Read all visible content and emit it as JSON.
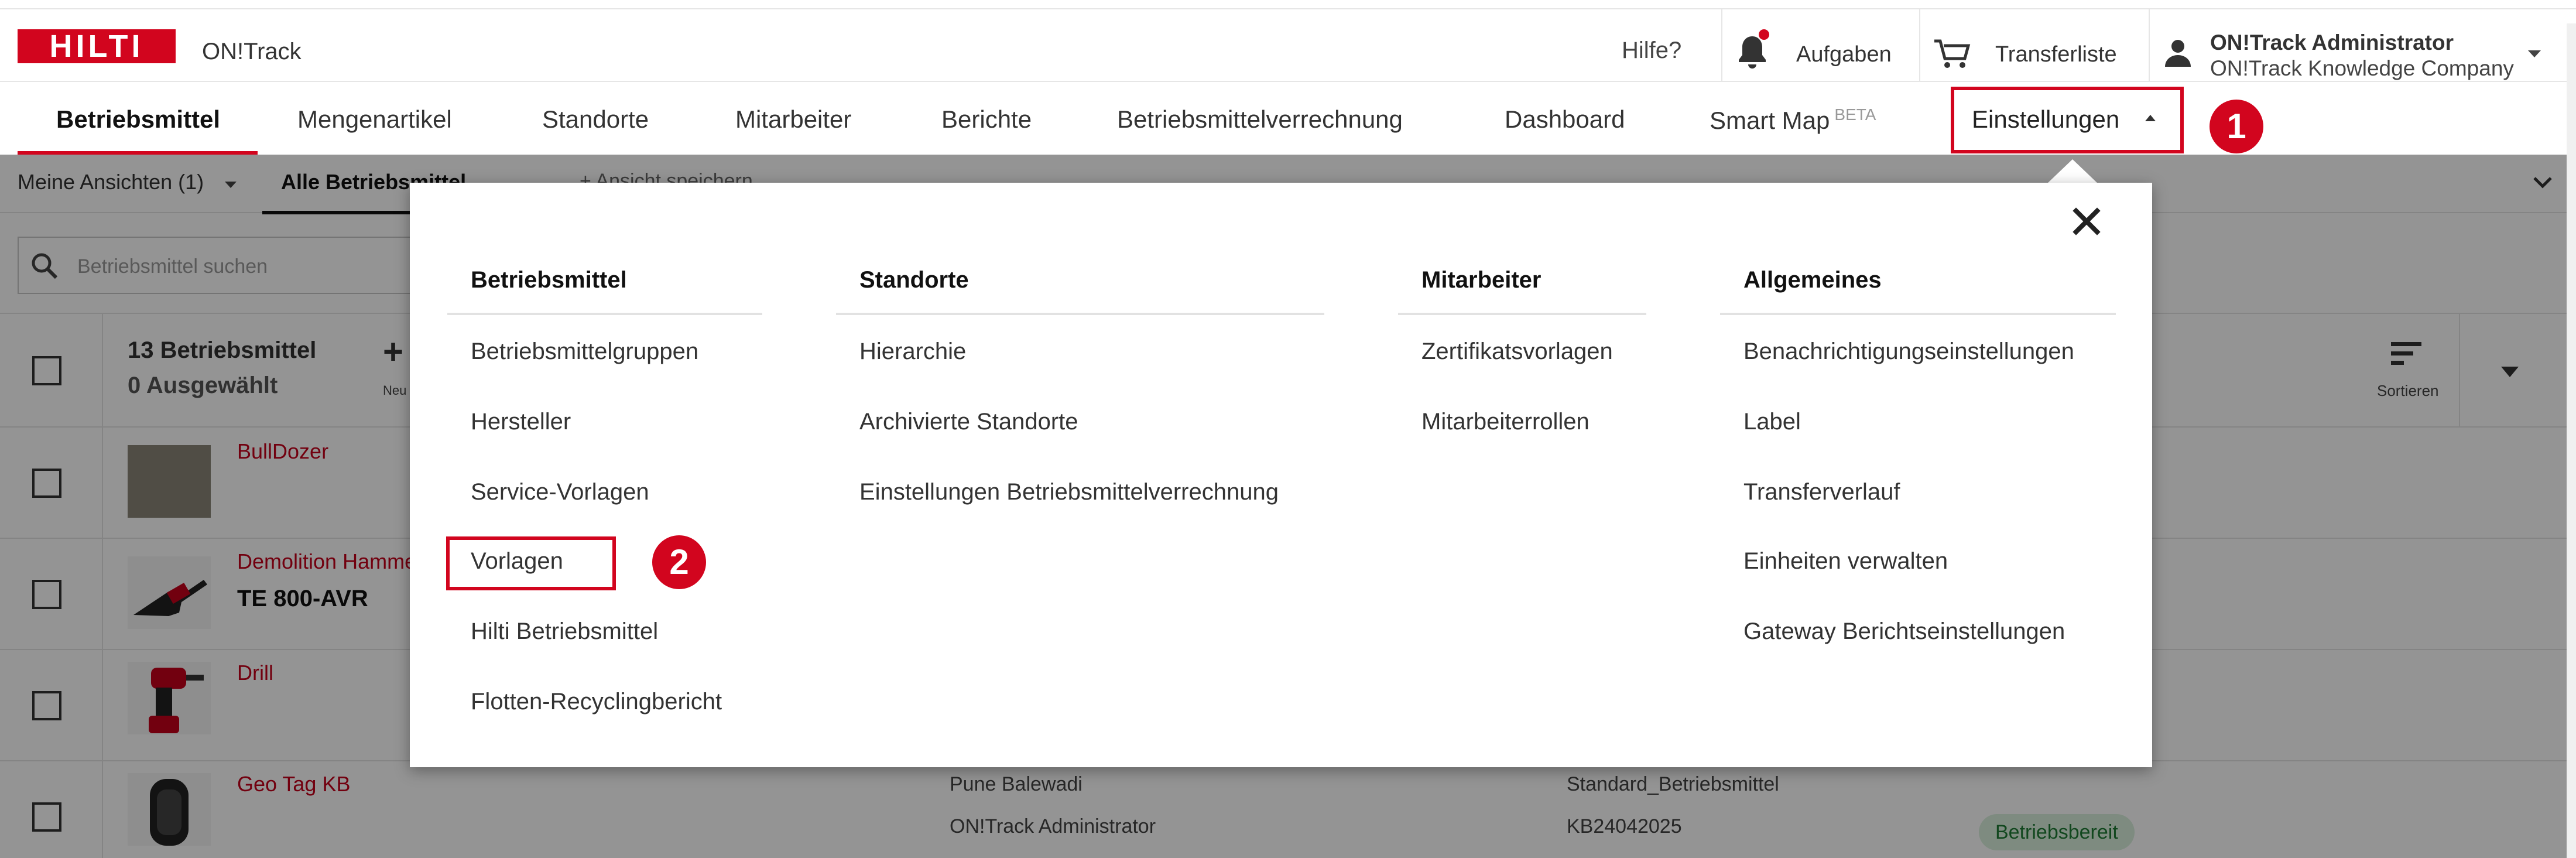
{
  "app": {
    "logo_text": "HILTI",
    "title": "ON!Track"
  },
  "topbar": {
    "help": "Hilfe?",
    "tasks": "Aufgaben",
    "transfer_list": "Transferliste",
    "user_name": "ON!Track Administrator",
    "user_company": "ON!Track Knowledge Company",
    "icons": [
      "bell-icon",
      "cart-icon",
      "user-icon",
      "chevron-down-icon"
    ]
  },
  "nav": {
    "items": [
      "Betriebsmittel",
      "Mengenartikel",
      "Standorte",
      "Mitarbeiter",
      "Berichte",
      "Betriebsmittelverrechnung",
      "Dashboard",
      "Smart Map",
      "Einstellungen"
    ],
    "beta": "BETA",
    "active": "Betriebsmittel",
    "open": "Einstellungen"
  },
  "annotations": {
    "badge1": "1",
    "badge2": "2",
    "color": "#d2051e"
  },
  "list_toolbar": {
    "my_views": "Meine Ansichten (1)",
    "all_assets": "Alle Betriebsmittel",
    "save_view": "+ Ansicht speichern",
    "search_placeholder": "Betriebsmittel suchen",
    "count": "13 Betriebsmittel",
    "selected": "0 Ausgewählt",
    "new_label": "Neu",
    "sort_label": "Sortieren"
  },
  "assets": [
    {
      "name": "BullDozer",
      "model": ""
    },
    {
      "name": "Demolition Hammer",
      "model": "TE 800-AVR"
    },
    {
      "name": "Drill",
      "model": ""
    },
    {
      "name": "Geo Tag KB",
      "model": "",
      "location": "Pune Balewadi",
      "responsible": "ON!Track Administrator",
      "group": "Standard_Betriebsmittel",
      "inventory": "KB24042025",
      "status": "Betriebsbereit"
    }
  ],
  "menu": {
    "columns": [
      {
        "heading": "Betriebsmittel",
        "links": [
          "Betriebsmittelgruppen",
          "Hersteller",
          "Service-Vorlagen",
          "Vorlagen",
          "Hilti Betriebsmittel",
          "Flotten-Recyclingbericht"
        ]
      },
      {
        "heading": "Standorte",
        "links": [
          "Hierarchie",
          "Archivierte Standorte",
          "Einstellungen Betriebsmittelverrechnung"
        ]
      },
      {
        "heading": "Mitarbeiter",
        "links": [
          "Zertifikatsvorlagen",
          "Mitarbeiterrollen"
        ]
      },
      {
        "heading": "Allgemeines",
        "links": [
          "Benachrichtigungseinstellungen",
          "Label",
          "Transferverlauf",
          "Einheiten verwalten",
          "Gateway Berichtseinstellungen"
        ]
      }
    ],
    "highlighted": "Vorlagen"
  }
}
